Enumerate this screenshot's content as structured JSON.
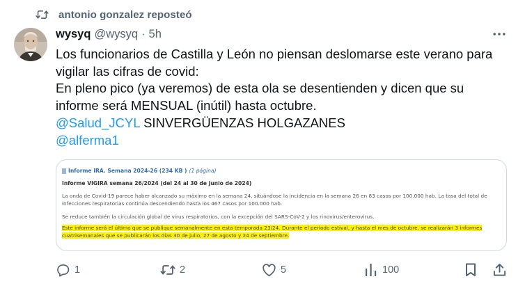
{
  "repost": {
    "icon": "repost-icon",
    "text": "antonio gonzalez reposteó"
  },
  "tweet": {
    "avatar_icon": "avatar-portrait",
    "display_name": "wysyq",
    "handle": "@wysyq",
    "separator": "·",
    "time": "5h",
    "more_icon": "more-dots-icon",
    "text": {
      "line1": "Los funcionarios de Castilla y León no piensan deslomarse este verano para",
      "line2": "vigilar las cifras de covid:",
      "line3": "En pleno pico (ya veremos) de esta ola se desentienden y dicen que su",
      "line4": "informe será MENSUAL (inútil) hasta octubre.",
      "mention1": "@Salud_JCYL",
      "line5_rest": " SINVERGÜENZAS HOLGAZANES",
      "mention2": "@alferma1"
    },
    "media": {
      "link_text": "Informe IRA. Semana 2024-26 (234 KB )",
      "pages_text": "(1 página)",
      "title": "Informe VIGIRA semana 26/2024 (del 24 al 30 de junio de 2024)",
      "para1": "La onda de Covid-19 parece haber alcanzado su máximo en la semana 24, situándose la incidencia en la semana 26 en 83 casos por 100.000 hab. La tasa del total de infecciones respiratorias continúa descendiendo hasta los 467 casos por 100.000 hab.",
      "para2": "Se reduce también la circulación global de virus respiratorios, con la excepción del SARS-CoV-2 y los rinovirus/enterovirus.",
      "para3_line1": "Este informe será el último que se publique semanalmente en esta temporada 23/24. Durante el periodo estival, y hasta el mes de octubre, se realizarán 3 informes",
      "para3_line2": "cuatrisemanales que se publicarán los días 30 de julio, 27 de agosto y 24 de septiembre."
    },
    "actions": {
      "reply_count": "1",
      "repost_count": "2",
      "like_count": "5",
      "views_count": "100"
    }
  },
  "colors": {
    "text": "#0f1419",
    "muted": "#536471",
    "link": "#1d9bf0",
    "border": "#cfd9de",
    "highlight": "#fff200"
  }
}
